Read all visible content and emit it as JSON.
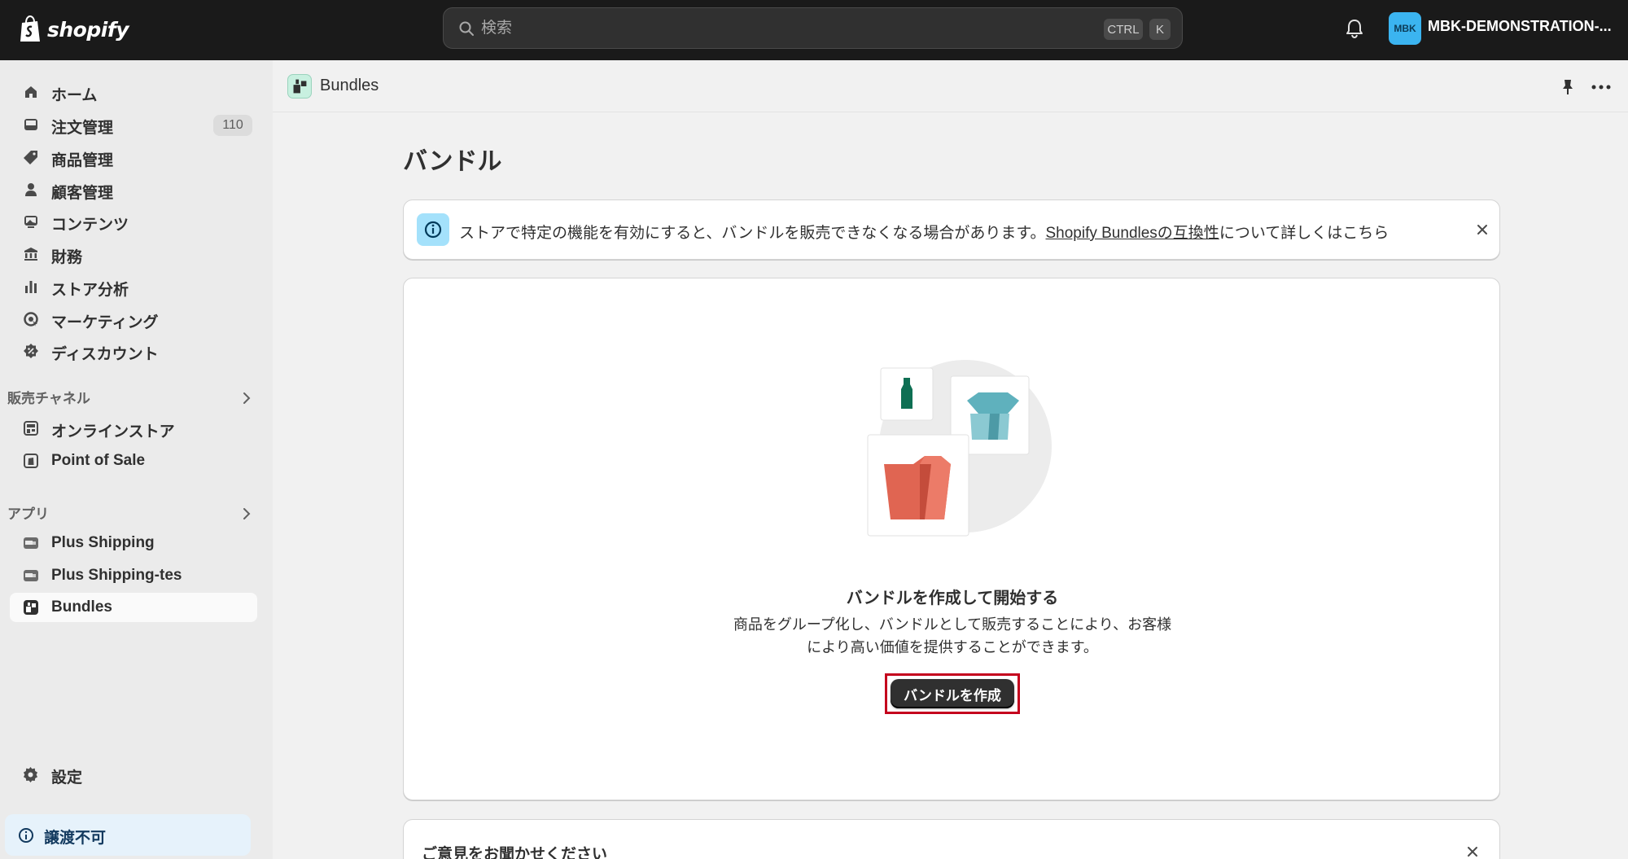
{
  "topbar": {
    "logo_text": "shopify",
    "search_placeholder": "検索",
    "shortcut_ctrl": "CTRL",
    "shortcut_k": "K",
    "avatar_initials": "MBK",
    "store_name": "MBK-DEMONSTRATION-..."
  },
  "sidebar": {
    "main_items": [
      {
        "label": "ホーム",
        "icon": "home-icon"
      },
      {
        "label": "注文管理",
        "icon": "inbox-icon",
        "badge": "110"
      },
      {
        "label": "商品管理",
        "icon": "tag-icon"
      },
      {
        "label": "顧客管理",
        "icon": "person-icon"
      },
      {
        "label": "コンテンツ",
        "icon": "image-icon"
      },
      {
        "label": "財務",
        "icon": "bank-icon"
      },
      {
        "label": "ストア分析",
        "icon": "bar-chart-icon"
      },
      {
        "label": "マーケティング",
        "icon": "target-icon"
      },
      {
        "label": "ディスカウント",
        "icon": "discount-icon"
      }
    ],
    "channels_heading": "販売チャネル",
    "channels": [
      {
        "label": "オンラインストア",
        "icon": "store-icon"
      },
      {
        "label": "Point of Sale",
        "icon": "pos-icon"
      }
    ],
    "apps_heading": "アプリ",
    "apps": [
      {
        "label": "Plus Shipping",
        "icon": "truck-icon"
      },
      {
        "label": "Plus Shipping-tes",
        "icon": "truck-icon"
      },
      {
        "label": "Bundles",
        "icon": "bundles-icon"
      }
    ],
    "settings_label": "設定",
    "transfer_label": "譲渡不可"
  },
  "pagebar": {
    "app_title": "Bundles"
  },
  "main": {
    "page_title": "バンドル",
    "banner": {
      "text_before": "ストアで特定の機能を有効にすると、バンドルを販売できなくなる場合があります。",
      "link_text": "Shopify Bundlesの互換性",
      "text_after": "について詳しくはこちら"
    },
    "empty_state": {
      "title": "バンドルを作成して開始する",
      "description_line1": "商品をグループ化し、バンドルとして販売することにより、お客様",
      "description_line2": "により高い価値を提供することができます。",
      "cta_label": "バンドルを作成"
    },
    "feedback_title": "ご意見をお聞かせください"
  },
  "colors": {
    "topbar_bg": "#1a1a1a",
    "sidebar_bg": "#ebebeb",
    "primary_button": "#303030",
    "highlight_border": "#c4001d",
    "info_accent": "#a4e1fb",
    "illustration_red": "#e06552",
    "illustration_teal": "#5fb1bd",
    "illustration_green": "#0e6f53"
  }
}
